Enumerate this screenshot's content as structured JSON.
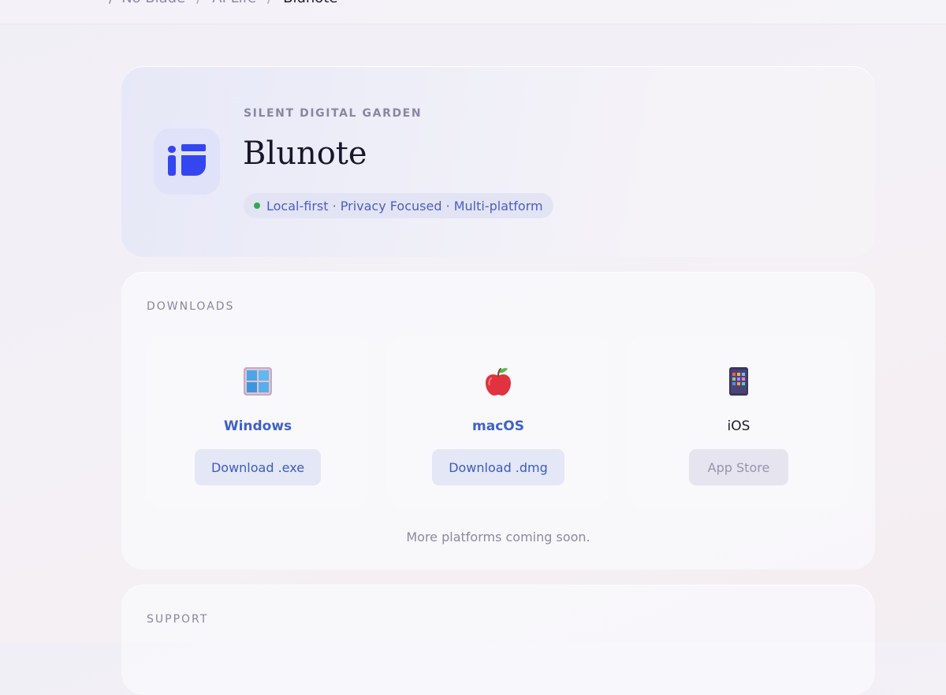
{
  "breadcrumb": {
    "items": [
      "No Blade",
      "AI Life"
    ],
    "current": "Blunote",
    "separator": "/"
  },
  "hero": {
    "eyebrow": "SILENT DIGITAL GARDEN",
    "title": "Blunote",
    "tagline": "Local-first · Privacy Focused · Multi-platform",
    "status_color": "#2faa55",
    "icon": "blunote-logo-icon"
  },
  "downloads": {
    "label": "DOWNLOADS",
    "platforms": [
      {
        "name": "Windows",
        "icon": "windows-icon",
        "button": "Download .exe",
        "enabled": true
      },
      {
        "name": "macOS",
        "icon": "apple-icon",
        "button": "Download .dmg",
        "enabled": true
      },
      {
        "name": "iOS",
        "icon": "mobile-phone-icon",
        "button": "App Store",
        "enabled": false
      }
    ],
    "footnote": "More platforms coming soon."
  },
  "support": {
    "label": "SUPPORT"
  },
  "colors": {
    "accent": "#3f62c6",
    "brand": "#3446f0",
    "muted": "#8a86a3"
  }
}
